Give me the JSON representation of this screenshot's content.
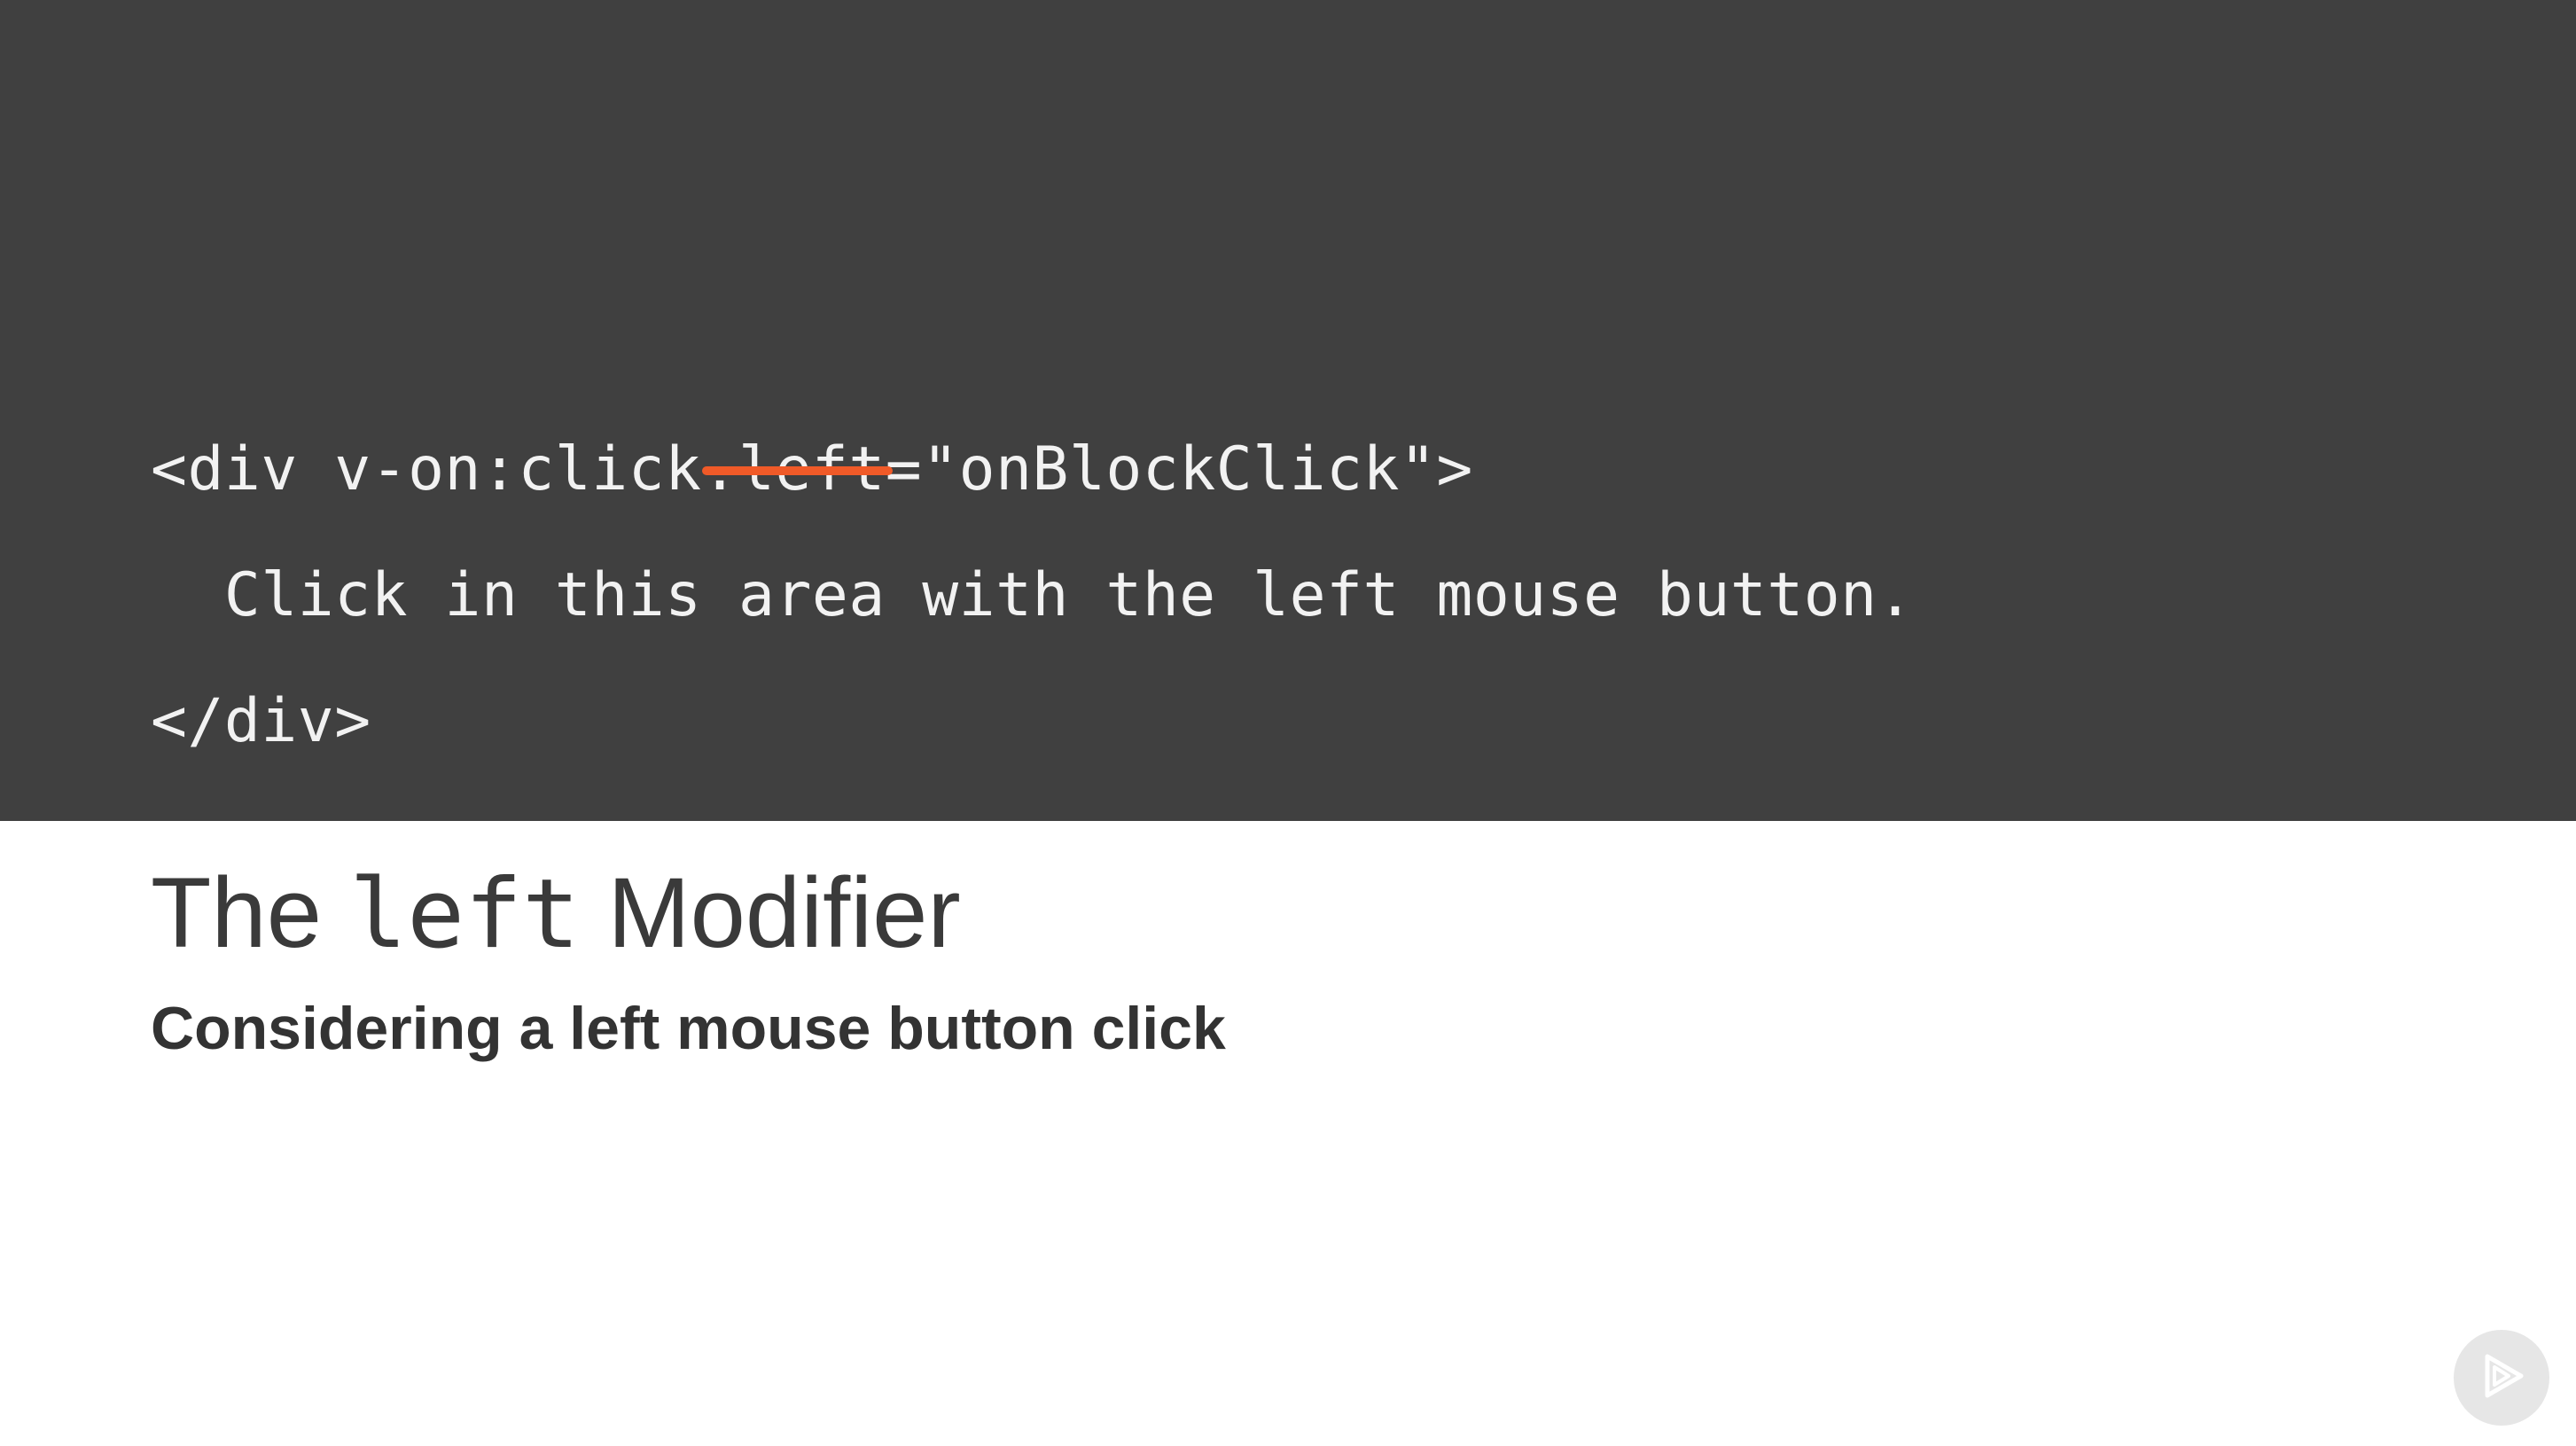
{
  "code": {
    "line1_prefix": "<div v-on:click",
    "line1_struck": ".left",
    "line1_suffix": "=\"onBlockClick\">",
    "line2": "  Click in this area with the left mouse button.",
    "line3": "</div>"
  },
  "slide": {
    "title_before": "The ",
    "title_mono": "left",
    "title_after": " Modifier",
    "subtitle": "Considering a left mouse button click"
  },
  "colors": {
    "code_background": "#404040",
    "code_text": "#f2f2f2",
    "strike_accent": "#f05a28",
    "title_text": "#3a3a3a",
    "subtitle_text": "#333333"
  },
  "icons": {
    "brand_badge": "play-icon"
  }
}
